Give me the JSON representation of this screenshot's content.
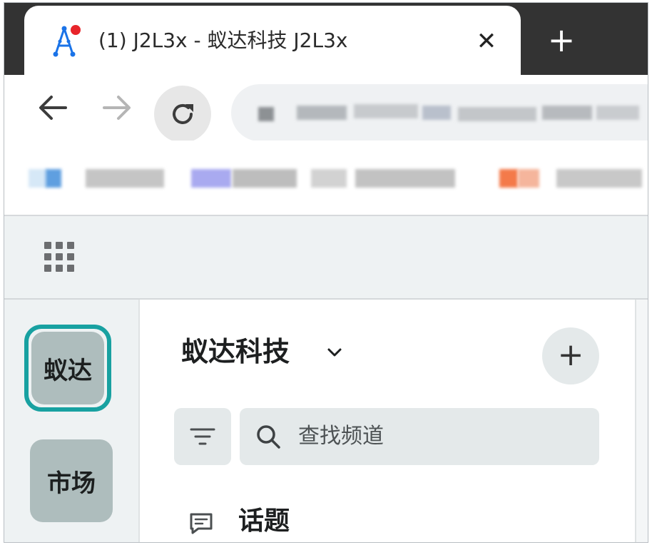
{
  "browser": {
    "tab": {
      "title": "(1) J2L3x - 蚁达科技 J2L3x",
      "favicon": "j2l3x-logo-icon",
      "close_icon": "close-icon"
    },
    "new_tab_icon": "plus-icon",
    "toolbar": {
      "back_icon": "arrow-left-icon",
      "forward_icon": "arrow-right-icon",
      "reload_icon": "reload-icon",
      "address_blurred": true
    },
    "bookmarks_blurred": true
  },
  "app": {
    "apps_icon": "app-grid-icon",
    "servers": [
      {
        "label": "蚁达",
        "selected": true
      },
      {
        "label": "市场",
        "selected": false
      }
    ],
    "workspace": {
      "name": "蚁达科技",
      "caret_icon": "chevron-down-icon",
      "add_icon": "plus-icon"
    },
    "filter_icon": "filter-icon",
    "search": {
      "placeholder": "查找频道",
      "icon": "search-icon"
    },
    "sections": [
      {
        "label": "话题",
        "icon": "message-icon"
      }
    ]
  },
  "colors": {
    "tabstrip": "#333333",
    "accent": "#18a1a1",
    "rail_bg": "#eef2f3",
    "server_tile": "#aebdbd",
    "control_bg": "#e4e9ea"
  }
}
